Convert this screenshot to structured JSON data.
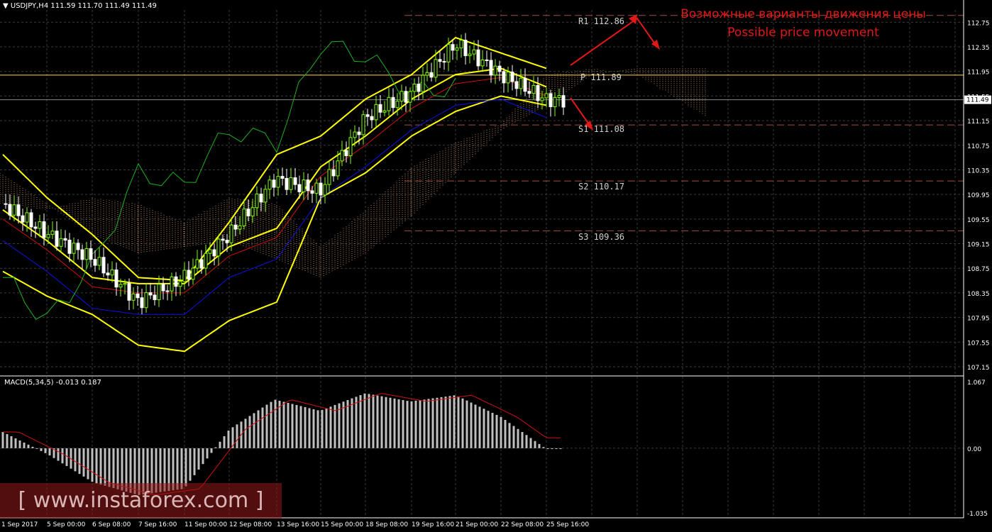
{
  "header": {
    "symbol_info": "USDJPY,H4  111.59 111.70 111.49 111.49",
    "macd_info": "MACD(5,34,5) -0.013 0.187"
  },
  "annotations": {
    "ru": "Возможные варианты движения цены",
    "en": "Possible price movement"
  },
  "levels": [
    {
      "label": "R1 112.86",
      "value": 112.86,
      "kind": "resistance"
    },
    {
      "label": "P 111.89",
      "value": 111.89,
      "kind": "pivot"
    },
    {
      "label": "S1 111.08",
      "value": 111.08,
      "kind": "support"
    },
    {
      "label": "S2 110.17",
      "value": 110.17,
      "kind": "support"
    },
    {
      "label": "S3 109.36",
      "value": 109.36,
      "kind": "support"
    }
  ],
  "price_axis": [
    "112.75",
    "112.35",
    "111.95",
    "111.55",
    "111.15",
    "110.75",
    "110.35",
    "109.95",
    "109.55",
    "109.15",
    "108.75",
    "108.35",
    "107.95",
    "107.55",
    "107.15"
  ],
  "current_price": "111.49",
  "macd_axis": [
    "1.067",
    "0.00",
    "-1.035"
  ],
  "time_axis": [
    "1 Sep 2017",
    "5 Sep 00:00",
    "6 Sep 08:00",
    "7 Sep 16:00",
    "11 Sep 00:00",
    "12 Sep 08:00",
    "13 Sep 16:00",
    "15 Sep 00:00",
    "18 Sep 08:00",
    "19 Sep 16:00",
    "21 Sep 00:00",
    "22 Sep 08:00",
    "25 Sep 16:00"
  ],
  "watermark": "[ www.instaforex.com ]",
  "colors": {
    "background": "#000000",
    "grid": "#3a3a3a",
    "bull": "#7fff00",
    "bear": "#ffffff",
    "bollinger": "#ffff00",
    "kijun": "#d01010",
    "tenkan": "#1010e0",
    "chikou": "#20b020",
    "cloud": "#e0a070",
    "pivot": "#ffd84a",
    "level": "#a05040",
    "macd_hist": "#c0c0c0",
    "macd_signal": "#d01010",
    "arrows": "#e01818"
  },
  "chart_data": [
    {
      "type": "line",
      "title": "USDJPY,H4",
      "ylim": [
        107.15,
        112.75
      ],
      "categories": [
        "1 Sep 2017",
        "5 Sep 00:00",
        "6 Sep 08:00",
        "7 Sep 16:00",
        "11 Sep 00:00",
        "12 Sep 08:00",
        "13 Sep 16:00",
        "15 Sep 00:00",
        "18 Sep 08:00",
        "19 Sep 16:00",
        "21 Sep 00:00",
        "22 Sep 08:00",
        "25 Sep 16:00"
      ],
      "series": [
        {
          "values": [
            109.8,
            109.3,
            108.9,
            108.2,
            108.6,
            109.3,
            110.2,
            110.0,
            111.2,
            111.6,
            112.4,
            111.9,
            111.49
          ]
        },
        {
          "values": [
            110.6,
            109.9,
            109.3,
            108.6,
            108.55,
            109.5,
            110.6,
            110.9,
            111.5,
            111.9,
            112.5,
            112.25,
            112.0
          ]
        },
        {
          "values": [
            109.7,
            109.2,
            108.6,
            108.5,
            108.5,
            109.1,
            109.4,
            110.4,
            110.9,
            111.5,
            111.9,
            112.0,
            111.7
          ]
        },
        {
          "values": [
            108.7,
            108.3,
            108.0,
            107.5,
            107.4,
            107.9,
            108.2,
            109.9,
            110.3,
            110.9,
            111.3,
            111.55,
            111.4
          ]
        }
      ]
    },
    {
      "type": "bar",
      "title": "MACD(5,34,5) -0.013 0.187",
      "ylim": [
        -1.035,
        1.067
      ],
      "categories": [
        "1 Sep 2017",
        "5 Sep 00:00",
        "6 Sep 08:00",
        "7 Sep 16:00",
        "11 Sep 00:00",
        "12 Sep 08:00",
        "13 Sep 16:00",
        "15 Sep 00:00",
        "18 Sep 08:00",
        "19 Sep 16:00",
        "21 Sep 00:00",
        "22 Sep 08:00",
        "25 Sep 16:00"
      ],
      "values": [
        0.26,
        -0.1,
        -0.55,
        -0.75,
        -0.65,
        0.3,
        0.78,
        0.6,
        0.88,
        0.75,
        0.85,
        0.5,
        -0.013
      ]
    }
  ]
}
